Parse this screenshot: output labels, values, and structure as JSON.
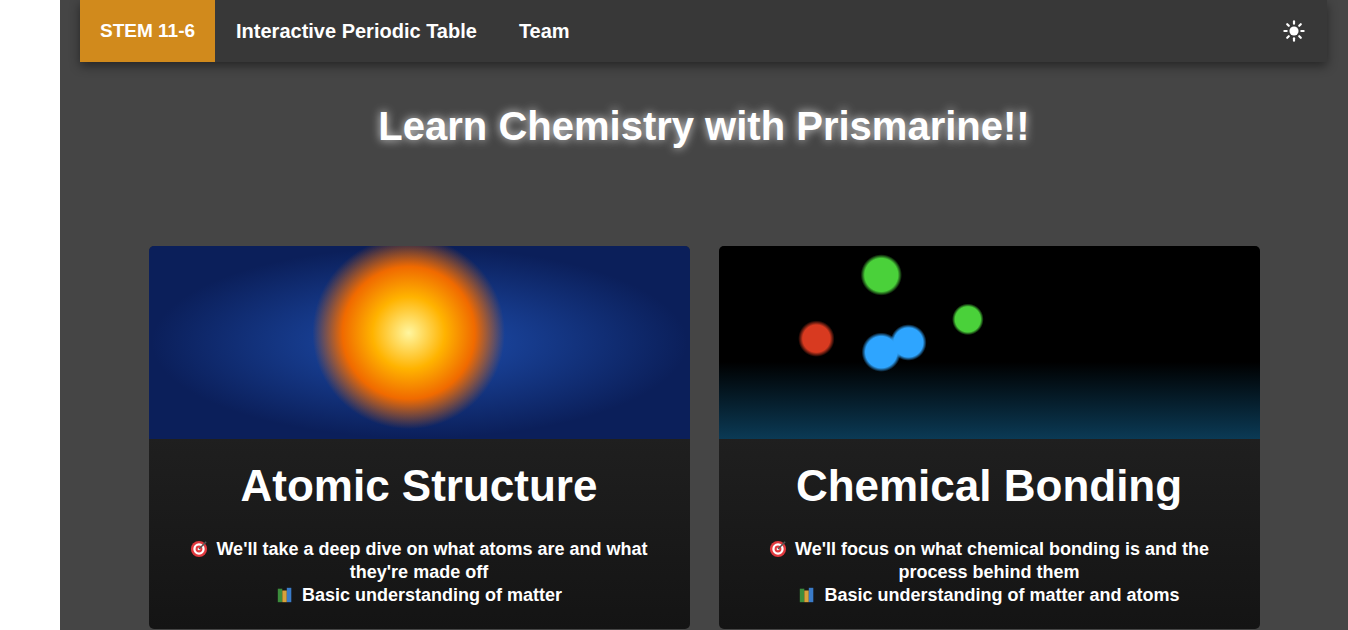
{
  "navbar": {
    "brand": "STEM 11-6",
    "links": [
      {
        "label": "Interactive Periodic Table"
      },
      {
        "label": "Team"
      }
    ]
  },
  "hero": {
    "title": "Learn Chemistry with Prismarine!!"
  },
  "cards": [
    {
      "title": "Atomic Structure",
      "goal": "We'll take a deep dive on what atoms are and what they're made off",
      "prerequisite": "Basic understanding of matter",
      "image": "atom"
    },
    {
      "title": "Chemical Bonding",
      "goal": "We'll focus on what chemical bonding is and the process behind them",
      "prerequisite": "Basic understanding of matter and atoms",
      "image": "molecule"
    }
  ]
}
